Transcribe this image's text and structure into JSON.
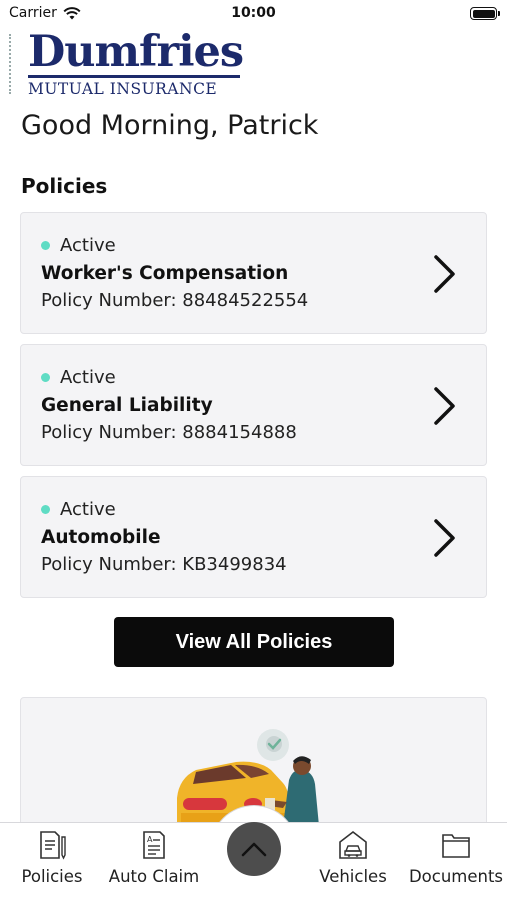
{
  "status_bar": {
    "carrier": "Carrier",
    "time": "10:00"
  },
  "logo": {
    "name": "Dumfries",
    "subtitle": "MUTUAL INSURANCE"
  },
  "greeting": "Good Morning, Patrick",
  "policies_section": {
    "title": "Policies",
    "items": [
      {
        "status": "Active",
        "name": "Worker's Compensation",
        "number": "Policy Number: 88484522554"
      },
      {
        "status": "Active",
        "name": "General Liability",
        "number": "Policy Number: 8884154888"
      },
      {
        "status": "Active",
        "name": "Automobile",
        "number": "Policy Number: KB3499834"
      }
    ],
    "view_all_label": "View All Policies"
  },
  "tabbar": {
    "items": [
      {
        "label": "Policies",
        "icon": "policy-document-icon"
      },
      {
        "label": "Auto Claim",
        "icon": "claim-form-icon"
      },
      {
        "label": "Vehicles",
        "icon": "garage-car-icon"
      },
      {
        "label": "Documents",
        "icon": "folder-icon"
      }
    ],
    "center_icon": "chevron-up-icon"
  },
  "colors": {
    "brand": "#1c2a6b",
    "active_dot": "#5fdcc4",
    "button": "#0b0b0b"
  }
}
